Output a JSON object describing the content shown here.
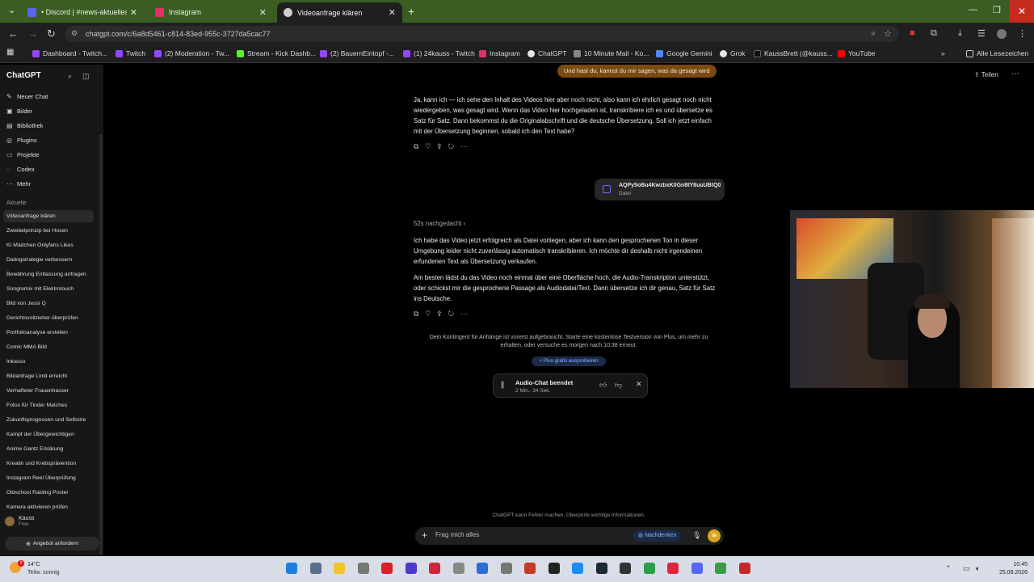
{
  "browser": {
    "tabs": [
      {
        "label": "• Discord | #news-aktuelles-no",
        "close": "✕",
        "favicon_color": "#5865f2"
      },
      {
        "label": "Instagram",
        "close": "✕",
        "favicon_color": "#e1306c"
      },
      {
        "label": "Videoanfrage klären",
        "close": "✕",
        "favicon_color": "#cfcfcf"
      }
    ],
    "new_tab": "+",
    "url": "chatgpt.com/c/6a8d5461-c814-83ed-955c-3727da5cac77",
    "bookmarks": [
      {
        "label": "Dashboard - Twitch...",
        "color": "#9146ff"
      },
      {
        "label": "Twitch",
        "color": "#9146ff"
      },
      {
        "label": "(2) Moderation - Tw...",
        "color": "#9146ff"
      },
      {
        "label": "Stream - Kick Dashb...",
        "color": "#53fc18"
      },
      {
        "label": "(2) BauernEintopf -...",
        "color": "#9146ff"
      },
      {
        "label": "(1) 24kauss - Twitch",
        "color": "#9146ff"
      },
      {
        "label": "Instagram",
        "color": "#e1306c"
      },
      {
        "label": "ChatGPT",
        "color": "#e6e6e6"
      },
      {
        "label": "10 Minute Mail - Ko...",
        "color": "#888888"
      },
      {
        "label": "Google Gemini",
        "color": "#4a8af4"
      },
      {
        "label": "Grok",
        "color": "#e6e6e6"
      },
      {
        "label": "KaussBrett (@kauss...",
        "color": "#111111"
      },
      {
        "label": "YouTube",
        "color": "#ff0000"
      }
    ],
    "all_bookmarks": "Alle Lesezeichen"
  },
  "sidebar": {
    "brand": "ChatGPT",
    "nav": [
      {
        "label": "Neuer Chat",
        "icon": "✎"
      },
      {
        "label": "Bilder",
        "icon": "▣"
      },
      {
        "label": "Bibliothek",
        "icon": "▤"
      },
      {
        "label": "Plugins",
        "icon": "◎"
      },
      {
        "label": "Projekte",
        "icon": "▭"
      },
      {
        "label": "Codex",
        "icon": "◌"
      },
      {
        "label": "Mehr",
        "icon": "⋯"
      }
    ],
    "recent_heading": "Aktuelle",
    "chats": [
      "Videoanfrage klären",
      "Zwiebelprinzip bei Hosen",
      "KI Mädchen Onlyfans Likes",
      "Datingstrategie verbessern",
      "Bewährung Entlassung anfragen",
      "Songremix mit Elektrotouch",
      "Bild von Jessi Q",
      "Gerichtsvollzieher überprüfen",
      "Portfolioanalyse erstellen",
      "Comic MMA Bild",
      "Inkasso",
      "Bildanfrage Limit erreicht",
      "Verhafteter Frauenhasser",
      "Fotos für Tinder Matches",
      "Zukunftsprognosen und Selbstre",
      "Kampf der Übergewichtigen",
      "Anime Gantz Erklärung",
      "Kreatin und Krebsprävention",
      "Instagram Reel Überprüfung",
      "Oldschool Raiding Poster",
      "Kamera aktivieren prüfen"
    ],
    "user_name": "Kauss",
    "user_plan": "Free",
    "offer_button": "Angebot anfordern"
  },
  "chat": {
    "share_label": "Teilen",
    "user_message": "Und hast du, kannst du mir sagen, was da gesagt wird",
    "assistant_reply_1": "Ja, kann ich — ich sehe den Inhalt des Videos hier aber noch nicht, also kann ich ehrlich gesagt noch nicht wiedergeben, was gesagt wird. Wenn das Video hier hochgeladen ist, transkribiere ich es und übersetze es Satz für Satz. Dann bekommst du die Originalabschrift und die deutsche Übersetzung. Soll ich jetzt einfach mit der Übersetzung beginnen, sobald ich den Text habe?",
    "file_name": "AQPy5oBu4KwzbxK0Gn8tY8uuUBtQ0...",
    "file_type": "Datei",
    "thought_label": "52s nachgedacht",
    "assistant_reply_2a": "Ich habe das Video jetzt erfolgreich als Datei vorliegen, aber ich kann den gesprochenen Ton in dieser Umgebung leider nicht zuverlässig automatisch transkribieren. Ich möchte dir deshalb nicht irgendeinen erfundenen Text als Übersetzung verkaufen.",
    "assistant_reply_2b": "Am besten lädst du das Video noch einmal über eine Oberfläche hoch, die Audio-Transkription unterstützt, oder schickst mir die gesprochene Passage als Audiodatei/Text. Dann übersetze ich dir genau, Satz für Satz ins Deutsche.",
    "quota_notice": "Dein Kontingent für Anhänge ist vorerst aufgebraucht. Starte eine kostenlose Testversion von Plus, um mehr zu erhalten, oder versuche es morgen nach 10:38 erneut.",
    "plus_button": "Plus gratis ausprobieren",
    "audio_title": "Audio-Chat beendet",
    "audio_duration": "2 Min., 34 Sek.",
    "disclaimer": "ChatGPT kann Fehler machen. Überprüfe wichtige Informationen.",
    "composer_placeholder": "Frag mich alles",
    "think_button": "Nachdenken"
  },
  "taskbar": {
    "weather_badge": "2",
    "temperature": "14°C",
    "weather": "Teilw. sonnig",
    "time": "10:45",
    "date": "25.08.2026",
    "apps": [
      {
        "icon": "windows-start-icon",
        "color": "#1e7fe0"
      },
      {
        "icon": "calculator-icon",
        "color": "#5a6f8a"
      },
      {
        "icon": "file-explorer-icon",
        "color": "#f2c230"
      },
      {
        "icon": "mouse-icon",
        "color": "#777777"
      },
      {
        "icon": "opera-gx-icon",
        "color": "#d81f26"
      },
      {
        "icon": "vegas-icon",
        "color": "#4a3acb"
      },
      {
        "icon": "app-red-icon",
        "color": "#d0243a"
      },
      {
        "icon": "app-grey-icon",
        "color": "#888888"
      },
      {
        "icon": "app-blue-icon",
        "color": "#2b6cd6"
      },
      {
        "icon": "app-sparkle-icon",
        "color": "#777777"
      },
      {
        "icon": "app-stripes-icon",
        "color": "#c33b2a"
      },
      {
        "icon": "obs-icon",
        "color": "#222222"
      },
      {
        "icon": "app-circle-icon",
        "color": "#1d8cf0"
      },
      {
        "icon": "steam-icon",
        "color": "#1b2838"
      },
      {
        "icon": "app-capture-icon",
        "color": "#333333"
      },
      {
        "icon": "chrome-icon",
        "color": "#2a9d4a"
      },
      {
        "icon": "opera-icon",
        "color": "#e0243a"
      },
      {
        "icon": "discord-icon",
        "color": "#5865f2"
      },
      {
        "icon": "app-layers-icon",
        "color": "#3b9c46"
      },
      {
        "icon": "app-media-icon",
        "color": "#c62828"
      }
    ]
  }
}
